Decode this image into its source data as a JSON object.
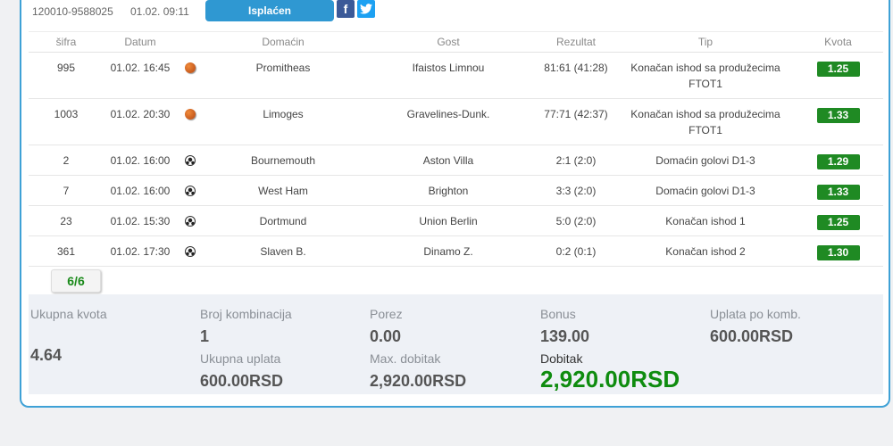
{
  "ticket": {
    "id": "120010-9588025",
    "date": "01.02. 09:11",
    "status": "Isplaćen",
    "share_facebook": "f",
    "share_twitter": "t"
  },
  "table": {
    "headers": [
      "šifra",
      "Datum",
      "",
      "Domaćin",
      "Gost",
      "Rezultat",
      "Tip",
      "Kvota"
    ],
    "rows": [
      {
        "code": "995",
        "date": "01.02. 16:45",
        "sport_icon": "basketball-icon",
        "home": "Promitheas",
        "away": "Ifaistos Limnou",
        "result": "81:61 (41:28)",
        "tip": "Konačan ishod sa produžecima FTOT1",
        "odds": "1.25"
      },
      {
        "code": "1003",
        "date": "01.02. 20:30",
        "sport_icon": "basketball-icon",
        "home": "Limoges",
        "away": "Gravelines-Dunk.",
        "result": "77:71 (42:37)",
        "tip": "Konačan ishod sa produžecima FTOT1",
        "odds": "1.33"
      },
      {
        "code": "2",
        "date": "01.02. 16:00",
        "sport_icon": "soccer-ball-icon",
        "home": "Bournemouth",
        "away": "Aston Villa",
        "result": "2:1 (2:0)",
        "tip": "Domaćin golovi D1-3",
        "odds": "1.29"
      },
      {
        "code": "7",
        "date": "01.02. 16:00",
        "sport_icon": "soccer-ball-icon",
        "home": "West Ham",
        "away": "Brighton",
        "result": "3:3 (2:0)",
        "tip": "Domaćin golovi D1-3",
        "odds": "1.33"
      },
      {
        "code": "23",
        "date": "01.02. 15:30",
        "sport_icon": "soccer-ball-icon",
        "home": "Dortmund",
        "away": "Union Berlin",
        "result": "5:0 (2:0)",
        "tip": "Konačan ishod 1",
        "odds": "1.25"
      },
      {
        "code": "361",
        "date": "01.02. 17:30",
        "sport_icon": "soccer-ball-icon",
        "home": "Slaven B.",
        "away": "Dinamo Z.",
        "result": "0:2 (0:1)",
        "tip": "Konačan ishod 2",
        "odds": "1.30"
      }
    ]
  },
  "match_count": "6/6",
  "summary": {
    "total_odds_label": "Ukupna kvota",
    "total_odds": "4.64",
    "combinations_label": "Broj kombinacija",
    "combinations": "1",
    "total_stake_label": "Ukupna uplata",
    "total_stake": "600.00RSD",
    "tax_label": "Porez",
    "tax": "0.00",
    "max_win_label": "Max. dobitak",
    "max_win": "2,920.00RSD",
    "bonus_label": "Bonus",
    "bonus": "139.00",
    "win_label": "Dobitak",
    "win": "2,920.00RSD",
    "stake_per_comb_label": "Uplata po komb.",
    "stake_per_comb": "600.00RSD"
  },
  "colors": {
    "accent": "#2f98d2",
    "border": "#3ea1d6",
    "odds_bg": "#1f8a23",
    "win_text": "#0f8c0f",
    "summary_bg": "#eef1f6"
  }
}
